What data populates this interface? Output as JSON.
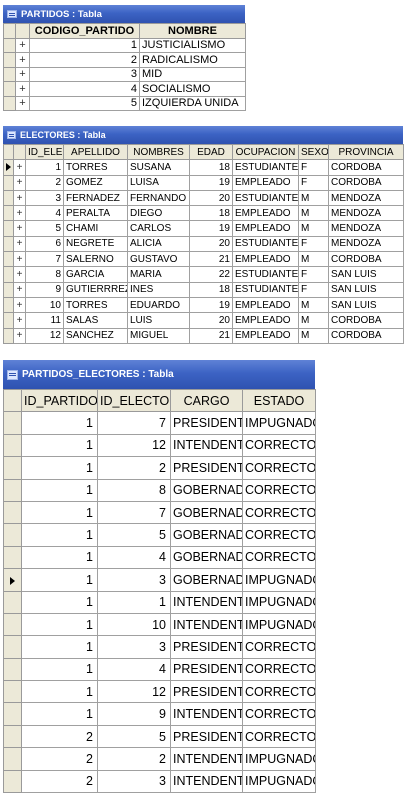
{
  "partidos": {
    "title": "PARTIDOS : Tabla",
    "columns": [
      "CODIGO_PARTIDO",
      "NOMBRE"
    ],
    "rows": [
      {
        "codigo": "1",
        "nombre": "JUSTICIALISMO"
      },
      {
        "codigo": "2",
        "nombre": "RADICALISMO"
      },
      {
        "codigo": "3",
        "nombre": "MID"
      },
      {
        "codigo": "4",
        "nombre": "SOCIALISMO"
      },
      {
        "codigo": "5",
        "nombre": "IZQUIERDA UNIDA"
      }
    ]
  },
  "electores": {
    "title": "ELECTORES : Tabla",
    "columns": [
      "ID_ELEC",
      "APELLIDO",
      "NOMBRES",
      "EDAD",
      "OCUPACION",
      "SEXO",
      "PROVINCIA"
    ],
    "rows": [
      {
        "id": "1",
        "apellido": "TORRES",
        "nombres": "SUSANA",
        "edad": "18",
        "ocupacion": "ESTUDIANTE",
        "sexo": "F",
        "provincia": "CORDOBA"
      },
      {
        "id": "2",
        "apellido": "GOMEZ",
        "nombres": "LUISA",
        "edad": "19",
        "ocupacion": "EMPLEADO",
        "sexo": "F",
        "provincia": "CORDOBA"
      },
      {
        "id": "3",
        "apellido": "FERNADEZ",
        "nombres": "FERNANDO",
        "edad": "20",
        "ocupacion": "ESTUDIANTE",
        "sexo": "M",
        "provincia": "MENDOZA"
      },
      {
        "id": "4",
        "apellido": "PERALTA",
        "nombres": "DIEGO",
        "edad": "18",
        "ocupacion": "EMPLEADO",
        "sexo": "M",
        "provincia": "MENDOZA"
      },
      {
        "id": "5",
        "apellido": "CHAMI",
        "nombres": "CARLOS",
        "edad": "19",
        "ocupacion": "EMPLEADO",
        "sexo": "M",
        "provincia": "MENDOZA"
      },
      {
        "id": "6",
        "apellido": "NEGRETE",
        "nombres": "ALICIA",
        "edad": "20",
        "ocupacion": "ESTUDIANTE",
        "sexo": "F",
        "provincia": "MENDOZA"
      },
      {
        "id": "7",
        "apellido": "SALERNO",
        "nombres": "GUSTAVO",
        "edad": "21",
        "ocupacion": "EMPLEADO",
        "sexo": "M",
        "provincia": "CORDOBA"
      },
      {
        "id": "8",
        "apellido": "GARCIA",
        "nombres": "MARIA",
        "edad": "22",
        "ocupacion": "ESTUDIANTE",
        "sexo": "F",
        "provincia": "SAN LUIS"
      },
      {
        "id": "9",
        "apellido": "GUTIERRREZ",
        "nombres": "INES",
        "edad": "18",
        "ocupacion": "ESTUDIANTE",
        "sexo": "F",
        "provincia": "SAN LUIS"
      },
      {
        "id": "10",
        "apellido": "TORRES",
        "nombres": "EDUARDO",
        "edad": "19",
        "ocupacion": "EMPLEADO",
        "sexo": "M",
        "provincia": "SAN LUIS"
      },
      {
        "id": "11",
        "apellido": "SALAS",
        "nombres": "LUIS",
        "edad": "20",
        "ocupacion": "EMPLEADO",
        "sexo": "M",
        "provincia": "CORDOBA"
      },
      {
        "id": "12",
        "apellido": "SANCHEZ",
        "nombres": "MIGUEL",
        "edad": "21",
        "ocupacion": "EMPLEADO",
        "sexo": "M",
        "provincia": "CORDOBA"
      }
    ]
  },
  "partidos_electores": {
    "title": "PARTIDOS_ELECTORES : Tabla",
    "columns": [
      "ID_PARTIDO",
      "ID_ELECTOR",
      "CARGO",
      "ESTADO"
    ],
    "rows": [
      {
        "partido": "1",
        "elector": "7",
        "cargo": "PRESIDENTE",
        "estado": "IMPUGNADO"
      },
      {
        "partido": "1",
        "elector": "12",
        "cargo": "INTENDENTE",
        "estado": "CORRECTO"
      },
      {
        "partido": "1",
        "elector": "2",
        "cargo": "PRESIDENTE",
        "estado": "CORRECTO"
      },
      {
        "partido": "1",
        "elector": "8",
        "cargo": "GOBERNADOR",
        "estado": "CORRECTO"
      },
      {
        "partido": "1",
        "elector": "7",
        "cargo": "GOBERNADOR",
        "estado": "CORRECTO"
      },
      {
        "partido": "1",
        "elector": "5",
        "cargo": "GOBERNADOR",
        "estado": "CORRECTO"
      },
      {
        "partido": "1",
        "elector": "4",
        "cargo": "GOBERNADOR",
        "estado": "CORRECTO"
      },
      {
        "partido": "1",
        "elector": "3",
        "cargo": "GOBERNADOR",
        "estado": "IMPUGNADO"
      },
      {
        "partido": "1",
        "elector": "1",
        "cargo": "INTENDENTE",
        "estado": "IMPUGNADO"
      },
      {
        "partido": "1",
        "elector": "10",
        "cargo": "INTENDENTE",
        "estado": "IMPUGNADO"
      },
      {
        "partido": "1",
        "elector": "3",
        "cargo": "PRESIDENTE",
        "estado": "CORRECTO"
      },
      {
        "partido": "1",
        "elector": "4",
        "cargo": "PRESIDENTE",
        "estado": "CORRECTO"
      },
      {
        "partido": "1",
        "elector": "12",
        "cargo": "PRESIDENTE",
        "estado": "CORRECTO"
      },
      {
        "partido": "1",
        "elector": "9",
        "cargo": "INTENDENTE",
        "estado": "CORRECTO"
      },
      {
        "partido": "2",
        "elector": "5",
        "cargo": "PRESIDENTE",
        "estado": "CORRECTO"
      },
      {
        "partido": "2",
        "elector": "2",
        "cargo": "INTENDENTE",
        "estado": "IMPUGNADO"
      },
      {
        "partido": "2",
        "elector": "3",
        "cargo": "INTENDENTE",
        "estado": "IMPUGNADO"
      }
    ]
  },
  "icons": {
    "window": "table-window-icon",
    "expand": "plus-icon",
    "current_row": "record-pointer-icon"
  },
  "colors": {
    "titlebar": "#3c63c4",
    "header_bg": "#ece9d8",
    "grid": "#a0a0a0"
  }
}
